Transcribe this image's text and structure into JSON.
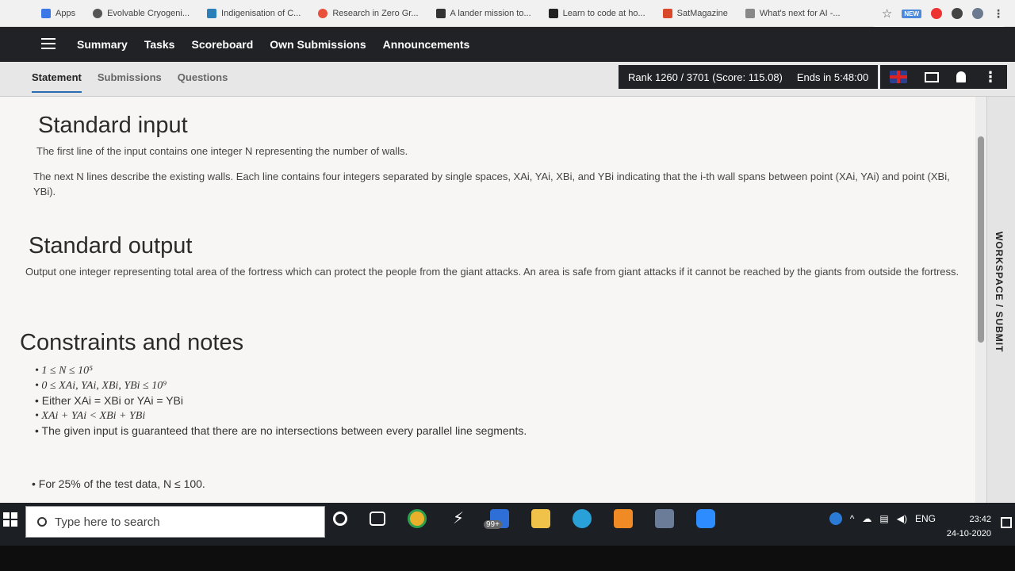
{
  "bookmarks": {
    "items": [
      {
        "label": "Apps",
        "color": "#3b78e7"
      },
      {
        "label": "Evolvable Cryogeni...",
        "color": "#555555"
      },
      {
        "label": "Indigenisation of C...",
        "color": "#2a7fb8"
      },
      {
        "label": "Research in Zero Gr...",
        "color": "#e8503a"
      },
      {
        "label": "A lander mission to...",
        "color": "#333333"
      },
      {
        "label": "Learn to code at ho...",
        "color": "#222222"
      },
      {
        "label": "SatMagazine",
        "color": "#d9482b"
      },
      {
        "label": "What's next for AI -...",
        "color": "#888888"
      }
    ],
    "new_badge": "NEW"
  },
  "nav": {
    "items": [
      "Summary",
      "Tasks",
      "Scoreboard",
      "Own Submissions",
      "Announcements"
    ]
  },
  "subnav": {
    "tabs": [
      "Statement",
      "Submissions",
      "Questions"
    ],
    "rank": "Rank 1260 / 3701 (Score: 115.08)",
    "ends": "Ends in 5:48:00"
  },
  "statement": {
    "input_heading": "Standard input",
    "input_line1": "The first line of the input contains one integer N representing the number of walls.",
    "input_line2": "The next N lines describe the existing walls. Each line contains four integers separated by single spaces, XAi, YAi, XBi, and YBi indicating that the i-th wall spans between point (XAi, YAi) and point (XBi, YBi).",
    "output_heading": "Standard output",
    "output_text": "Output one integer representing total area of the fortress which can protect the people from the giant attacks. An area is safe from giant attacks if it cannot be reached by the giants from outside the fortress.",
    "constraints_heading": "Constraints and notes",
    "constraints": [
      "1 ≤ N ≤ 10⁵",
      "0 ≤ XAi, YAi, XBi, YBi ≤ 10⁹",
      "Either XAi = XBi or YAi = YBi",
      "XAi + YAi < XBi + YBi",
      "The given input is guaranteed that there are no intersections between every parallel line segments."
    ],
    "tests": [
      "For 25% of the test data, N ≤ 100."
    ]
  },
  "rail": {
    "label": "WORKSPACE / SUBMIT"
  },
  "taskbar": {
    "search_placeholder": "Type here to search",
    "badge": "99+",
    "lang": "ENG",
    "time": "23:42",
    "date": "24-10-2020"
  }
}
